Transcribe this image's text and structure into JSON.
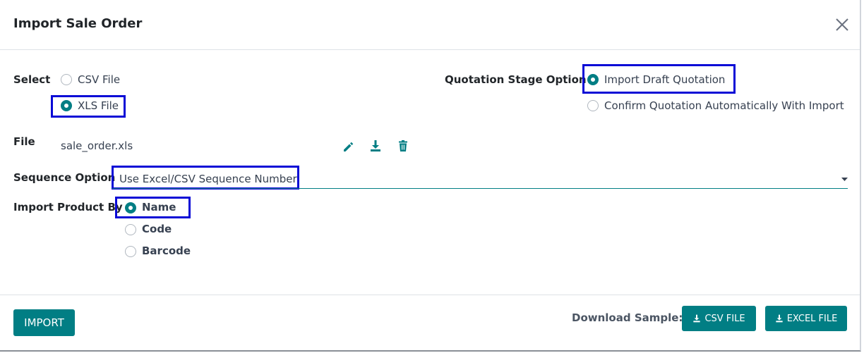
{
  "dialog": {
    "title": "Import Sale Order"
  },
  "select": {
    "label": "Select",
    "options": [
      "CSV File",
      "XLS File"
    ],
    "selected": "XLS File"
  },
  "quotation": {
    "label": "Quotation Stage Option",
    "options": [
      "Import Draft Quotation",
      "Confirm Quotation Automatically With Import"
    ],
    "selected": "Import Draft Quotation"
  },
  "file": {
    "label": "File",
    "filename": "sale_order.xls"
  },
  "sequence": {
    "label": "Sequence Option",
    "value": "Use Excel/CSV Sequence Number"
  },
  "import_by": {
    "label": "Import Product By",
    "options": [
      "Name",
      "Code",
      "Barcode"
    ],
    "selected": "Name"
  },
  "footer": {
    "import_button": "IMPORT",
    "download_label": "Download Sample:",
    "csv_button": "CSV FILE",
    "excel_button": "EXCEL FILE"
  },
  "colors": {
    "primary": "#017e84",
    "highlight": "#0a0ad6"
  }
}
